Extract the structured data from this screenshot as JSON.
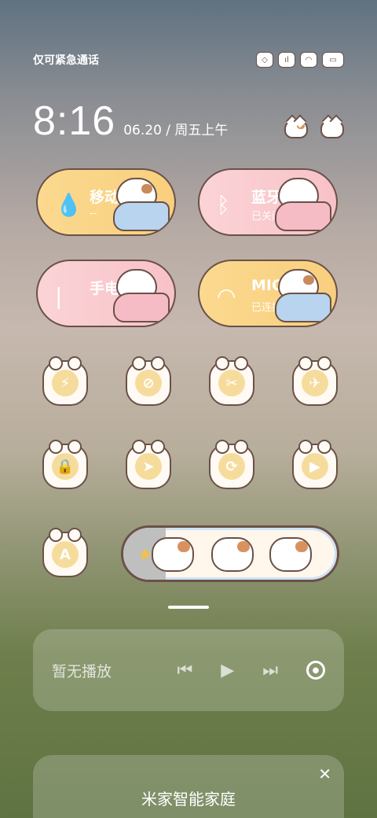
{
  "status_bar": {
    "carrier": "仅可紧急通话"
  },
  "clock": {
    "time": "8:16",
    "date": "06.20 / 周五上午"
  },
  "tiles": [
    {
      "title": "移动数据",
      "sub": "--",
      "icon": "water-drop-icon",
      "color": "#fbd98f"
    },
    {
      "title": "蓝牙",
      "sub": "已关闭",
      "icon": "bluetooth-icon",
      "color": "#fbd3d6"
    },
    {
      "title": "手电筒",
      "sub": "",
      "icon": "flashlight-icon",
      "color": "#fbd3d6"
    },
    {
      "title": "MIOffi",
      "sub": "已连接",
      "icon": "wifi-icon",
      "color": "#fbd98f"
    }
  ],
  "round_tiles_icons": [
    "flashlight-icon",
    "no-disturb-icon",
    "screenshot-icon",
    "airplane-icon",
    "lock-icon",
    "location-icon",
    "rotate-lock-icon",
    "screen-record-icon",
    "auto-brightness-icon"
  ],
  "round_tile_glyphs": [
    "⚡",
    "⊘",
    "✂",
    "✈",
    "🔒",
    "➤",
    "⟳",
    "▶",
    "A"
  ],
  "brightness": {
    "level": 0.2,
    "star": "★"
  },
  "media": {
    "label": "暂无播放",
    "prev": "⏮",
    "play": "▶",
    "next": "⏭"
  },
  "home_card": {
    "title": "米家智能家庭",
    "close": "✕"
  }
}
